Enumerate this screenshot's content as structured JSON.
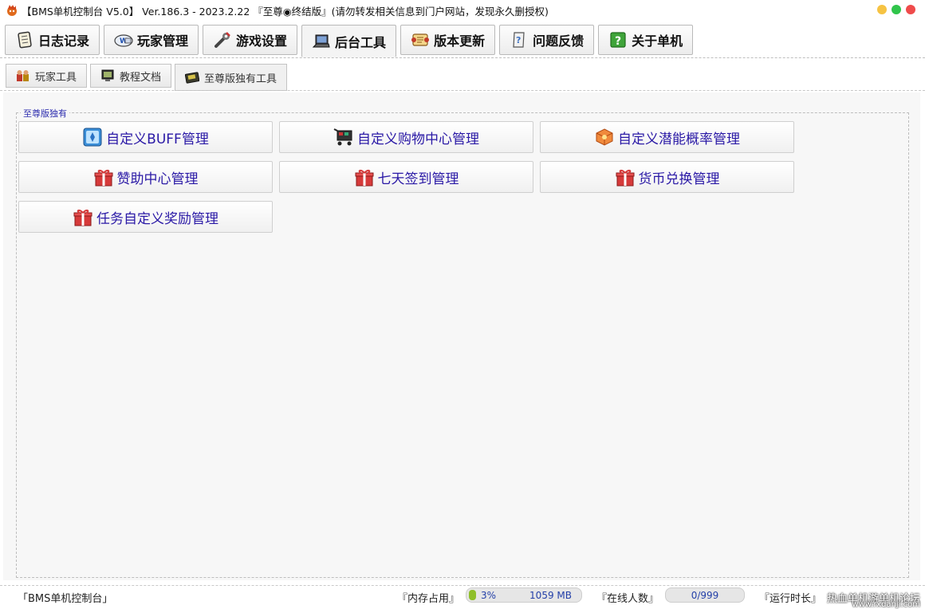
{
  "window": {
    "title": "【BMS单机控制台 V5.0】 Ver.186.3 - 2023.2.22 『至尊◉终结版』(请勿转发相关信息到门户网站，发现永久删授权)"
  },
  "main_tabs": [
    {
      "label": "日志记录"
    },
    {
      "label": "玩家管理"
    },
    {
      "label": "游戏设置"
    },
    {
      "label": "后台工具"
    },
    {
      "label": "版本更新"
    },
    {
      "label": "问题反馈"
    },
    {
      "label": "关于单机"
    }
  ],
  "sub_tabs": [
    {
      "label": "玩家工具"
    },
    {
      "label": "教程文档"
    },
    {
      "label": "至尊版独有工具"
    }
  ],
  "group": {
    "legend": "至尊版独有"
  },
  "features": [
    {
      "label": "自定义BUFF管理"
    },
    {
      "label": "自定义购物中心管理"
    },
    {
      "label": "自定义潜能概率管理"
    },
    {
      "label": "赞助中心管理"
    },
    {
      "label": "七天签到管理"
    },
    {
      "label": "货币兑换管理"
    },
    {
      "label": "任务自定义奖励管理"
    }
  ],
  "status": {
    "app_label": "「BMS单机控制台」",
    "memory_label": "『内存占用』",
    "memory_percent": "3%",
    "memory_mb": "1059 MB",
    "online_label": "『在线人数』",
    "online_value": "0/999",
    "runtime_label": "『运行时长』"
  },
  "watermark": {
    "line1": "热血单机游单机论坛",
    "line2": "www.rxdanji.com"
  },
  "colors": {
    "accent_text": "#2a19a6",
    "dot_yellow": "#f6c343",
    "dot_green": "#30c54b",
    "dot_red": "#ef4b4b"
  },
  "icons": {
    "main_tabs": [
      "notebook-icon",
      "player-card-icon",
      "wrench-icon",
      "laptop-icon",
      "scroll-icon",
      "question-scroll-icon",
      "help-icon"
    ],
    "sub_tabs": [
      "players-icon",
      "monitor-icon",
      "vip-card-icon"
    ],
    "features": [
      "buff-icon",
      "shopping-cart-icon",
      "potential-cube-icon",
      "gift-box-icon",
      "gift-box-icon",
      "gift-box-icon",
      "gift-box-icon"
    ]
  }
}
